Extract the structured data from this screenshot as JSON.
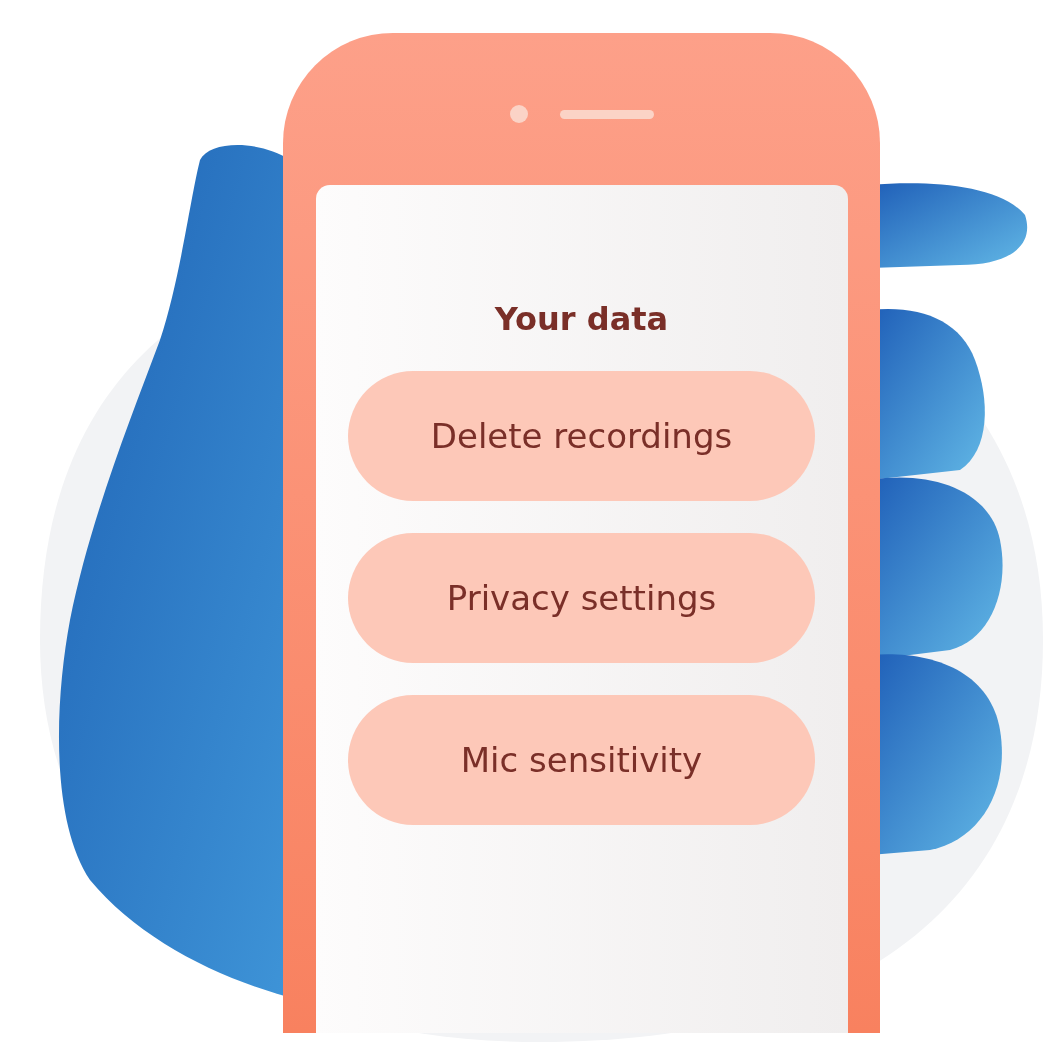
{
  "screen": {
    "title": "Your data",
    "buttons": [
      {
        "label": "Delete recordings"
      },
      {
        "label": "Privacy settings"
      },
      {
        "label": "Mic sensitivity"
      }
    ]
  }
}
